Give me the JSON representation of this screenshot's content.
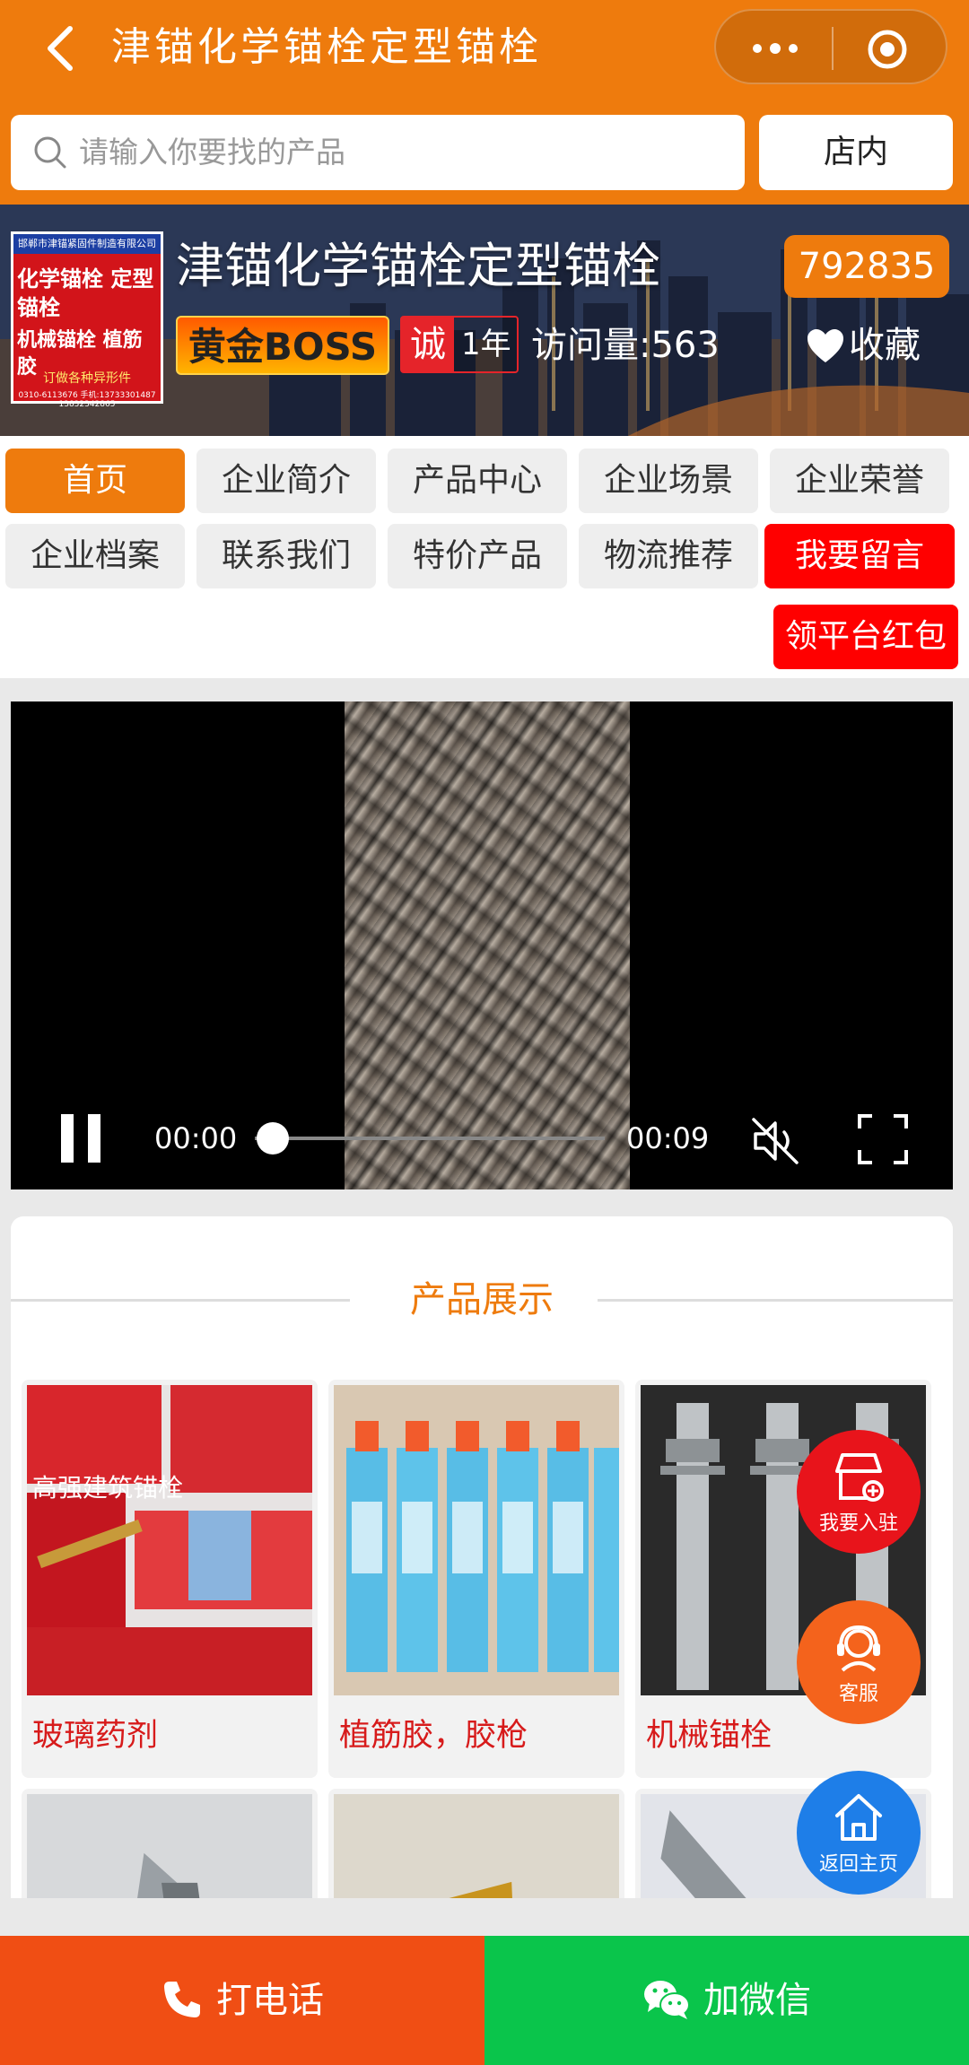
{
  "header": {
    "title": "津锚化学锚栓定型锚栓",
    "search_placeholder": "请输入你要找的产品",
    "instore_label": "店内"
  },
  "banner": {
    "shop_name": "津锚化学锚栓定型锚栓",
    "shop_id": "792835",
    "level_badge": "黄金BOSS",
    "cheng_char": "诚",
    "years": "1年",
    "visits": "访问量:563",
    "favorite_label": "收藏",
    "logo": {
      "top": "邯郸市津锚紧固件制造有限公司",
      "line1": "化学锚栓 定型锚栓",
      "line2": "机械锚栓 植筋胶",
      "line3": "订做各种异形件",
      "line4": "0310-6113676 手机:13733301487 13832342865"
    }
  },
  "nav": {
    "items": [
      "首页",
      "企业简介",
      "产品中心",
      "企业场景",
      "企业荣誉",
      "企业档案",
      "联系我们",
      "特价产品",
      "物流推荐",
      "我要留言",
      "领平台红包"
    ]
  },
  "video": {
    "current_time": "00:00",
    "duration": "00:09",
    "progress": 0.05
  },
  "products": {
    "section_title": "产品展示",
    "items": [
      {
        "name": "玻璃药剂"
      },
      {
        "name": "植筋胶，胶枪"
      },
      {
        "name": "机械锚栓"
      },
      {
        "name": ""
      },
      {
        "name": ""
      },
      {
        "name": ""
      }
    ]
  },
  "floating": {
    "join_label": "我要入驻",
    "service_label": "客服",
    "home_label": "返回主页"
  },
  "bottom": {
    "call_label": "打电话",
    "wechat_label": "加微信"
  },
  "colors": {
    "accent": "#ee7b0d",
    "red": "#ff0000",
    "call": "#f04e14",
    "wechat": "#0ac54b",
    "home": "#1e7ee8"
  }
}
